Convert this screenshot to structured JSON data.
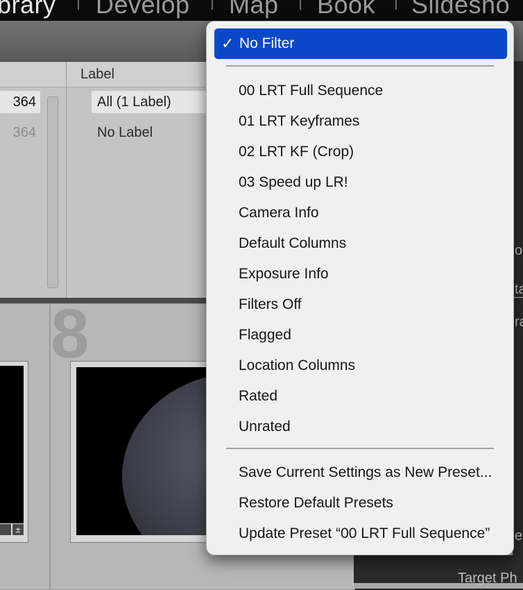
{
  "modules": [
    {
      "label": "brary",
      "active": true
    },
    {
      "label": "Develop",
      "active": false
    },
    {
      "label": "Map",
      "active": false
    },
    {
      "label": "Book",
      "active": false
    },
    {
      "label": "Slidesho",
      "active": false
    }
  ],
  "metadata_browser": {
    "label_column_header": "Label",
    "rows": [
      {
        "count": "364",
        "label": "All (1 Label)",
        "selected": true
      },
      {
        "count": "364",
        "label": "No Label",
        "selected": false
      }
    ]
  },
  "grid": {
    "cell_number": "8"
  },
  "right_panel": {
    "fragments": [
      "o",
      "ta",
      "ra",
      "e"
    ],
    "bottom_label": "Target Ph"
  },
  "filter_menu": {
    "checkmark": "✓",
    "selected": "No Filter",
    "presets": [
      "00 LRT Full Sequence",
      "01 LRT Keyframes",
      "02 LRT KF (Crop)",
      "03 Speed up LR!",
      "Camera Info",
      "Default Columns",
      "Exposure Info",
      "Filters Off",
      "Flagged",
      "Location Columns",
      "Rated",
      "Unrated"
    ],
    "actions": [
      "Save Current Settings as New Preset...",
      "Restore Default Presets",
      "Update Preset “00 LRT Full Sequence”"
    ]
  },
  "colors": {
    "menu_highlight": "#0b48c8",
    "menu_background": "#f0f0f0"
  }
}
